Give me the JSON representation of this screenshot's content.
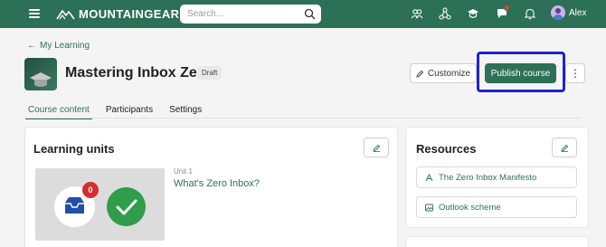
{
  "nav": {
    "brand": "MOUNTAINGEAR",
    "search_placeholder": "Search...",
    "user_name": "Alex",
    "icons": [
      "menu-icon",
      "people-icon",
      "network-icon",
      "graduation-cap-icon",
      "chat-icon",
      "bell-icon"
    ],
    "colors": {
      "bar": "#2d7058",
      "notification": "#e53935"
    }
  },
  "header": {
    "back_link": "My Learning",
    "course_title": "Mastering Inbox Zero",
    "status_badge": "Draft",
    "customize_label": "Customize",
    "publish_label": "Publish course",
    "more_icon": "more-vertical-icon",
    "highlight_color": "#2222cc"
  },
  "tabs": [
    {
      "label": "Course content",
      "active": true
    },
    {
      "label": "Participants",
      "active": false
    },
    {
      "label": "Settings",
      "active": false
    }
  ],
  "learning_units": {
    "title": "Learning units",
    "units": [
      {
        "number": "Unit 1",
        "title": "What's Zero Inbox?",
        "badge_count": "0"
      }
    ]
  },
  "resources": {
    "title": "Resources",
    "items": [
      {
        "label": "The Zero Inbox Manifesto",
        "icon": "pdf-icon"
      },
      {
        "label": "Outlook scheme",
        "icon": "image-icon"
      }
    ]
  }
}
